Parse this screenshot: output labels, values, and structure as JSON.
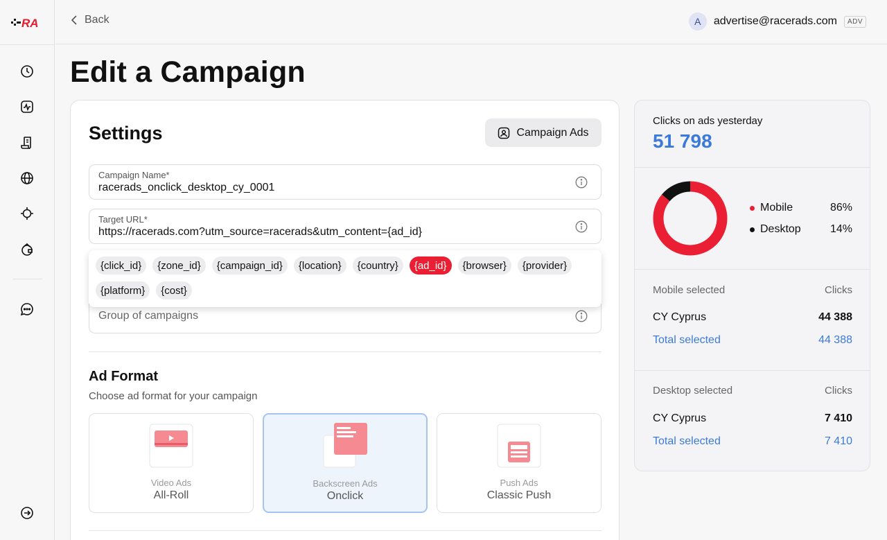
{
  "app": {
    "logo_text": "RA"
  },
  "topbar": {
    "back_label": "Back",
    "user_initial": "A",
    "user_email": "advertise@racerads.com",
    "user_role": "ADV"
  },
  "sidebar": {
    "items": [
      {
        "icon": "clock-icon"
      },
      {
        "icon": "activity-icon"
      },
      {
        "icon": "document-icon"
      },
      {
        "icon": "globe-icon"
      },
      {
        "icon": "crosshair-icon"
      },
      {
        "icon": "wallet-icon"
      },
      {
        "icon": "chat-icon"
      }
    ],
    "logout_icon": "logout-icon"
  },
  "page": {
    "title": "Edit a Campaign"
  },
  "settings": {
    "title": "Settings",
    "campaign_ads_label": "Campaign Ads",
    "campaign_name": {
      "label": "Campaign Name*",
      "value": "racerads_onclick_desktop_cy_0001"
    },
    "target_url": {
      "label": "Target URL*",
      "value": "https://racerads.com?utm_source=racerads&utm_content={ad_id}"
    },
    "macros": [
      "{click_id}",
      "{zone_id}",
      "{campaign_id}",
      "{location}",
      "{country}",
      "{ad_id}",
      "{browser}",
      "{provider}",
      "{platform}",
      "{cost}"
    ],
    "active_macro": "{ad_id}",
    "group": {
      "placeholder": "Group of campaigns"
    }
  },
  "ad_format": {
    "title": "Ad Format",
    "subtitle": "Choose ad format for your campaign",
    "options": [
      {
        "type": "Video Ads",
        "name": "All-Roll",
        "selected": false
      },
      {
        "type": "Backscreen Ads",
        "name": "Onclick",
        "selected": true
      },
      {
        "type": "Push Ads",
        "name": "Classic Push",
        "selected": false
      }
    ]
  },
  "stats": {
    "clicks_label": "Clicks on ads yesterday",
    "clicks_value": "51 798",
    "accent_color": "#3b7ad9",
    "breakdown": [
      {
        "name": "Mobile",
        "percent": "86%",
        "value": 86,
        "color": "#ea1f33"
      },
      {
        "name": "Desktop",
        "percent": "14%",
        "value": 14,
        "color": "#111111"
      }
    ],
    "mobile": {
      "header": "Mobile selected",
      "col": "Clicks",
      "rows": [
        {
          "name": "CY Cyprus",
          "value": "44 388"
        }
      ],
      "total_label": "Total selected",
      "total_value": "44 388"
    },
    "desktop": {
      "header": "Desktop selected",
      "col": "Clicks",
      "rows": [
        {
          "name": "CY Cyprus",
          "value": "7 410"
        }
      ],
      "total_label": "Total selected",
      "total_value": "7 410"
    }
  }
}
